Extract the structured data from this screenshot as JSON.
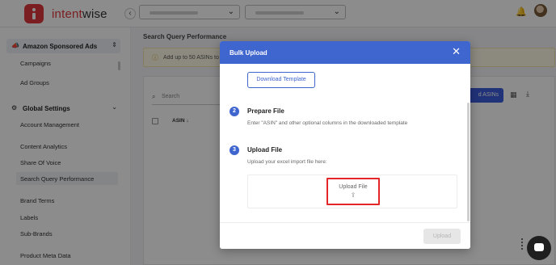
{
  "brand": {
    "name_part1": "intent",
    "name_part2": "wise",
    "accent": "#e0383e"
  },
  "topbar": {
    "collapse_icon": "chevron-left-icon",
    "bell_icon": "bell-icon"
  },
  "sidebar": {
    "group1": {
      "label": "Amazon Sponsored Ads",
      "icon": "megaphone-icon"
    },
    "group1_items": [
      "Campaigns",
      "Ad Groups"
    ],
    "group2": {
      "label": "Global Settings",
      "icon": "gear-icon"
    },
    "group2_items": [
      "Account Management",
      "Content Analytics",
      "Share Of Voice",
      "Search Query Performance",
      "Brand Terms",
      "Labels",
      "Sub-Brands",
      "Product Meta Data"
    ],
    "selected_item": "Search Query Performance"
  },
  "main": {
    "page_title": "Search Query Performance",
    "notice_text": "Add up to 50 ASINs to st",
    "search_placeholder": "Search",
    "column_asin": "ASIN",
    "add_button_partial": "d ASINs"
  },
  "modal": {
    "title": "Bulk Upload",
    "download_template_label": "Download Template",
    "step2_number": "2",
    "step2_title": "Prepare File",
    "step2_desc": "Enter \"ASIN\" and other optional columns in the downloaded template",
    "step3_number": "3",
    "step3_title": "Upload File",
    "step3_desc": "Upload your excel import file here:",
    "upload_file_label": "Upload File",
    "upload_button_label": "Upload",
    "header_color": "#3f65cf"
  }
}
